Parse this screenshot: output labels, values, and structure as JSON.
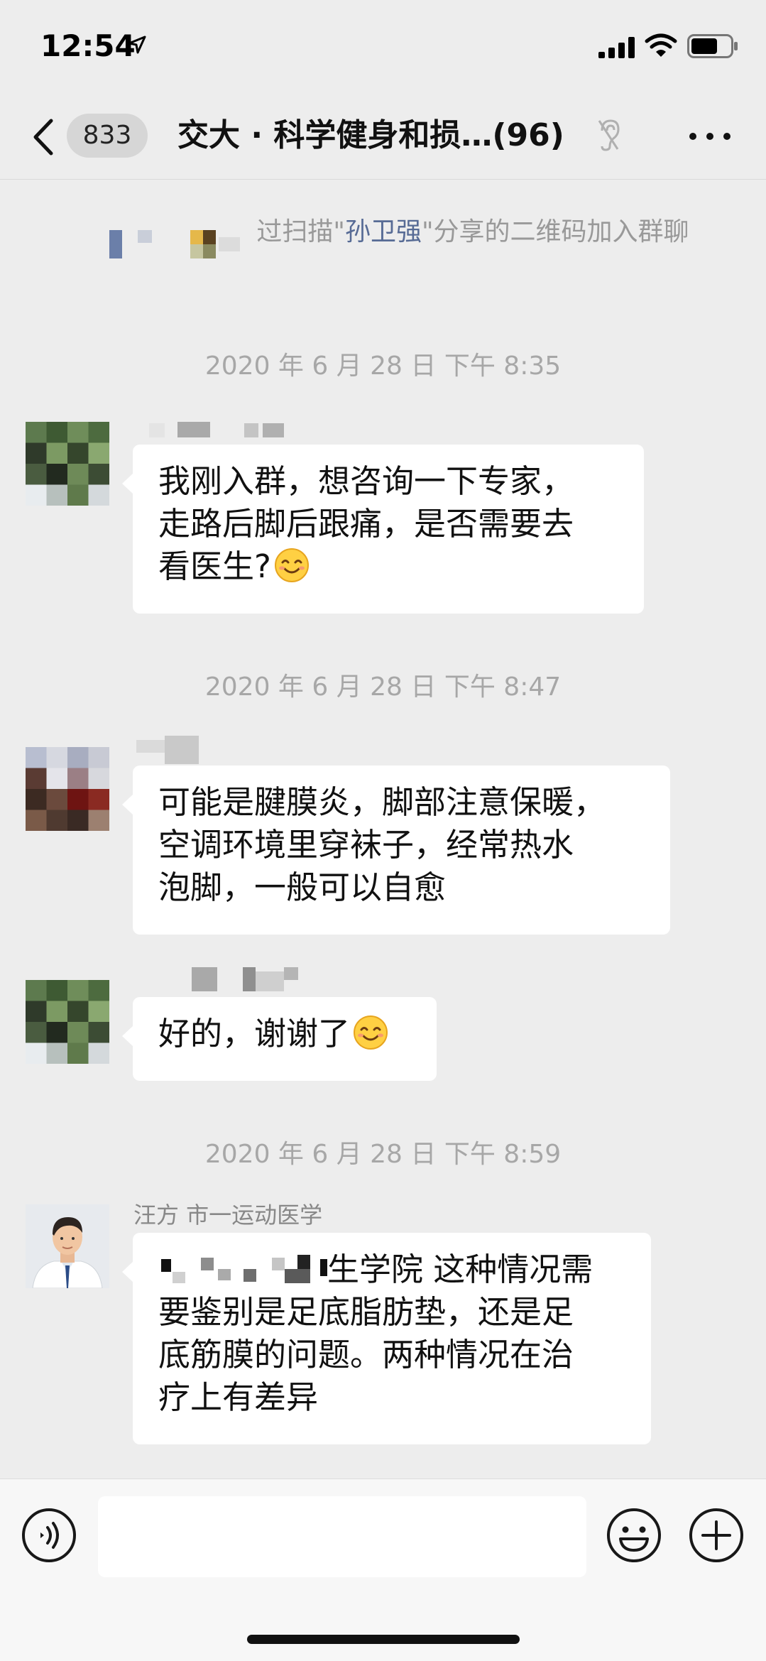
{
  "status": {
    "time": "12:54"
  },
  "nav": {
    "unread_count": "833",
    "title": "交大 · 科学健身和损…(96)",
    "icons": [
      "back-icon",
      "ear-icon",
      "more-icon"
    ]
  },
  "system_notice": {
    "before": "过扫描\"",
    "highlight": "孙卫强",
    "after": "\"分享的二维码加入群聊",
    "highlight_color": "#576b95"
  },
  "timestamps": [
    "2020 年 6 月 28 日 下午 8:35",
    "2020 年 6 月 28 日 下午 8:47",
    "2020 年 6 月 28 日 下午 8:59"
  ],
  "messages": [
    {
      "lines": [
        "我刚入群，想咨询一下专家，",
        "走路后脚后跟痛，是否需要去",
        "看医生?"
      ],
      "emoji": "smile"
    },
    {
      "lines": [
        "可能是腱膜炎，脚部注意保暖，",
        "空调环境里穿袜子，经常热水",
        "泡脚，一般可以自愈"
      ]
    },
    {
      "lines": [
        "好的，谢谢了"
      ],
      "emoji": "smile"
    },
    {
      "sender": "汪方 市一运动医学",
      "first_line_tail": "生学院 这种情况需",
      "lines": [
        "要鉴别是足底脂肪垫，还是足",
        "底筋膜的问题。两种情况在治",
        "疗上有差异"
      ]
    }
  ],
  "input": {
    "placeholder": ""
  },
  "colors": {
    "background": "#ededed",
    "bubble": "#ffffff",
    "timestamp": "#a7a7a7"
  }
}
